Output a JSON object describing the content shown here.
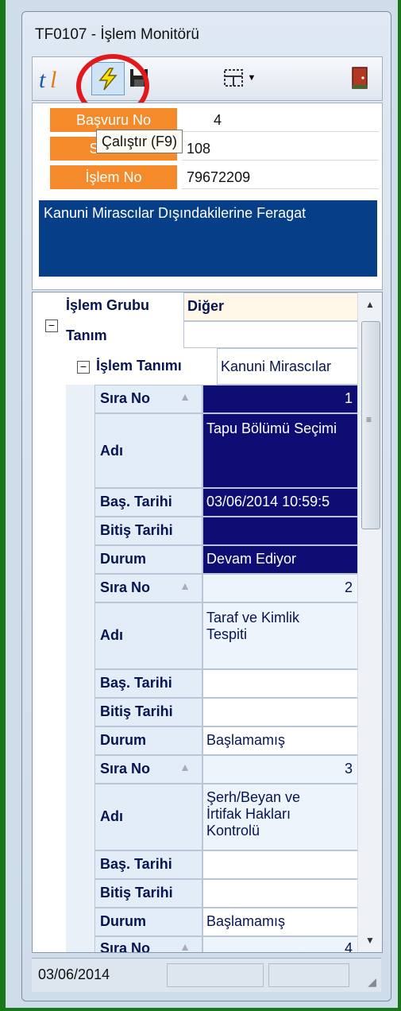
{
  "window": {
    "title": "TF0107 - İşlem Monitörü"
  },
  "toolbar": {
    "tooltip": "Çalıştır (F9)",
    "icons": [
      "logo-icon",
      "lightning-icon",
      "save-icon",
      "layout-icon",
      "chevron-down-icon",
      "exit-door-icon"
    ]
  },
  "fields": [
    {
      "label": "Başvuru No",
      "value": "4"
    },
    {
      "label": "Sıra No",
      "value": "108"
    },
    {
      "label": "İşlem No",
      "value": "79672209"
    }
  ],
  "description": "Kanuni Mirascılar Dışındakilerine Feragat",
  "grid": {
    "islem_grubu_label": "İşlem Grubu",
    "islem_grubu_value": "Diğer",
    "tanim_label": "Tanım",
    "islem_tanimi_label": "İşlem Tanımı",
    "islem_tanimi_value": "Kanuni Mirascılar",
    "row_labels": {
      "sira": "Sıra No",
      "adi": "Adı",
      "bas": "Baş. Tarihi",
      "bitis": "Bitiş Tarihi",
      "durum": "Durum"
    },
    "records": [
      {
        "sira": "1",
        "adi": "Tapu Bölümü Seçimi",
        "bas": "03/06/2014 10:59:5",
        "bitis": "",
        "durum": "Devam Ediyor"
      },
      {
        "sira": "2",
        "adi": "Taraf ve Kimlik Tespiti",
        "bas": "",
        "bitis": "",
        "durum": "Başlamamış"
      },
      {
        "sira": "3",
        "adi": "Şerh/Beyan ve İrtifak Hakları Kontrolü",
        "bas": "",
        "bitis": "",
        "durum": "Başlamamış"
      },
      {
        "sira": "4"
      }
    ]
  },
  "status": {
    "date": "03/06/2014"
  }
}
